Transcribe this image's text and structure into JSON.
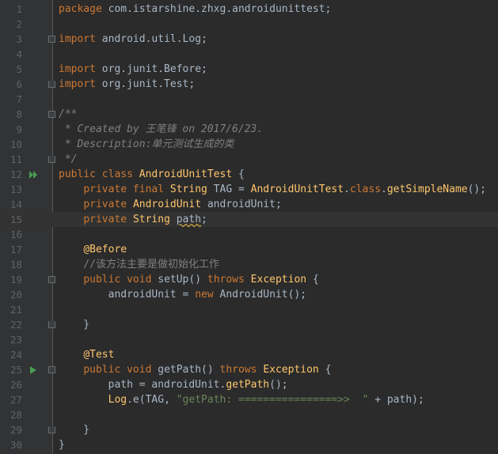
{
  "editor": {
    "colors": {
      "background": "#2b2b2b",
      "gutter": "#313335",
      "keyword": "#cc7832",
      "string": "#6a8759",
      "comment": "#808080",
      "annotation": "#bbb529",
      "function": "#ffc66d",
      "field": "#9876aa",
      "text": "#a9b7c6",
      "run_marker": "#499c54"
    },
    "lines": [
      {
        "num": "1",
        "marker": "",
        "fold": "",
        "tokens": [
          {
            "t": "package",
            "c": "kw"
          },
          {
            "t": " com.istarshine.zhxg.androidunittest;",
            "c": "pl"
          }
        ]
      },
      {
        "num": "2",
        "marker": "",
        "fold": "",
        "tokens": []
      },
      {
        "num": "3",
        "marker": "",
        "fold": "start",
        "tokens": [
          {
            "t": "import",
            "c": "kw"
          },
          {
            "t": " ",
            "c": "pl"
          },
          {
            "t": "android.util.Log;",
            "c": "pl"
          }
        ]
      },
      {
        "num": "4",
        "marker": "",
        "fold": "",
        "tokens": []
      },
      {
        "num": "5",
        "marker": "",
        "fold": "",
        "tokens": [
          {
            "t": "import",
            "c": "kw"
          },
          {
            "t": " org.junit.Before;",
            "c": "pl"
          }
        ]
      },
      {
        "num": "6",
        "marker": "",
        "fold": "end",
        "tokens": [
          {
            "t": "import",
            "c": "kw"
          },
          {
            "t": " org.junit.Test;",
            "c": "pl"
          }
        ]
      },
      {
        "num": "7",
        "marker": "",
        "fold": "",
        "tokens": []
      },
      {
        "num": "8",
        "marker": "",
        "fold": "start",
        "tokens": [
          {
            "t": "/**",
            "c": "cm"
          }
        ]
      },
      {
        "num": "9",
        "marker": "",
        "fold": "",
        "tokens": [
          {
            "t": " * Created by 王笔锋 on 2017/6/23.",
            "c": "cm"
          }
        ]
      },
      {
        "num": "10",
        "marker": "",
        "fold": "",
        "tokens": [
          {
            "t": " * Description:单元测试生成的类",
            "c": "cm"
          }
        ]
      },
      {
        "num": "11",
        "marker": "",
        "fold": "end",
        "tokens": [
          {
            "t": " */",
            "c": "cm"
          }
        ]
      },
      {
        "num": "12",
        "marker": "run-all",
        "fold": "",
        "tokens": [
          {
            "t": "public",
            "c": "kw"
          },
          {
            "t": " ",
            "c": "pl"
          },
          {
            "t": "class",
            "c": "kw"
          },
          {
            "t": " ",
            "c": "pl"
          },
          {
            "t": "AndroidUnitTest",
            "c": "an"
          },
          {
            "t": " {",
            "c": "pl"
          }
        ]
      },
      {
        "num": "13",
        "marker": "",
        "fold": "",
        "tokens": [
          {
            "t": "    ",
            "c": "pl"
          },
          {
            "t": "private final",
            "c": "kw"
          },
          {
            "t": " ",
            "c": "pl"
          },
          {
            "t": "String",
            "c": "an"
          },
          {
            "t": " TAG = ",
            "c": "pl"
          },
          {
            "t": "AndroidUnitTest",
            "c": "an"
          },
          {
            "t": ".",
            "c": "pl"
          },
          {
            "t": "class",
            "c": "kw"
          },
          {
            "t": ".",
            "c": "pl"
          },
          {
            "t": "getSimpleName",
            "c": "an"
          },
          {
            "t": "();",
            "c": "pl"
          }
        ]
      },
      {
        "num": "14",
        "marker": "",
        "fold": "",
        "tokens": [
          {
            "t": "    ",
            "c": "pl"
          },
          {
            "t": "private",
            "c": "kw"
          },
          {
            "t": " ",
            "c": "pl"
          },
          {
            "t": "AndroidUnit",
            "c": "an"
          },
          {
            "t": " androidUnit;",
            "c": "pl"
          }
        ]
      },
      {
        "num": "15",
        "marker": "",
        "fold": "",
        "current": true,
        "tokens": [
          {
            "t": "    ",
            "c": "pl"
          },
          {
            "t": "private",
            "c": "kw"
          },
          {
            "t": " ",
            "c": "pl"
          },
          {
            "t": "String",
            "c": "an"
          },
          {
            "t": " ",
            "c": "pl"
          },
          {
            "t": "path",
            "c": "warn"
          },
          {
            "t": ";",
            "c": "pl"
          }
        ]
      },
      {
        "num": "16",
        "marker": "",
        "fold": "",
        "tokens": []
      },
      {
        "num": "17",
        "marker": "",
        "fold": "",
        "tokens": [
          {
            "t": "    ",
            "c": "pl"
          },
          {
            "t": "@Before",
            "c": "an"
          }
        ]
      },
      {
        "num": "18",
        "marker": "",
        "fold": "",
        "tokens": [
          {
            "t": "    //该方法主要是做初始化工作",
            "c": "lc"
          }
        ]
      },
      {
        "num": "19",
        "marker": "",
        "fold": "start",
        "tokens": [
          {
            "t": "    ",
            "c": "pl"
          },
          {
            "t": "public",
            "c": "kw"
          },
          {
            "t": " ",
            "c": "pl"
          },
          {
            "t": "void",
            "c": "kw"
          },
          {
            "t": " setUp() ",
            "c": "pl"
          },
          {
            "t": "throws",
            "c": "kw"
          },
          {
            "t": " ",
            "c": "pl"
          },
          {
            "t": "Exception",
            "c": "an"
          },
          {
            "t": " {",
            "c": "pl"
          }
        ]
      },
      {
        "num": "20",
        "marker": "",
        "fold": "",
        "tokens": [
          {
            "t": "        androidUnit = ",
            "c": "pl"
          },
          {
            "t": "new",
            "c": "kw"
          },
          {
            "t": " AndroidUnit();",
            "c": "pl"
          }
        ]
      },
      {
        "num": "21",
        "marker": "",
        "fold": "",
        "tokens": []
      },
      {
        "num": "22",
        "marker": "",
        "fold": "end",
        "tokens": [
          {
            "t": "    }",
            "c": "pl"
          }
        ]
      },
      {
        "num": "23",
        "marker": "",
        "fold": "",
        "tokens": []
      },
      {
        "num": "24",
        "marker": "",
        "fold": "",
        "tokens": [
          {
            "t": "    ",
            "c": "pl"
          },
          {
            "t": "@Test",
            "c": "an"
          }
        ]
      },
      {
        "num": "25",
        "marker": "run",
        "fold": "start",
        "tokens": [
          {
            "t": "    ",
            "c": "pl"
          },
          {
            "t": "public",
            "c": "kw"
          },
          {
            "t": " ",
            "c": "pl"
          },
          {
            "t": "void",
            "c": "kw"
          },
          {
            "t": " getPath() ",
            "c": "pl"
          },
          {
            "t": "throws",
            "c": "kw"
          },
          {
            "t": " ",
            "c": "pl"
          },
          {
            "t": "Exception",
            "c": "an"
          },
          {
            "t": " {",
            "c": "pl"
          }
        ]
      },
      {
        "num": "26",
        "marker": "",
        "fold": "",
        "tokens": [
          {
            "t": "        path = androidUnit.",
            "c": "pl"
          },
          {
            "t": "getPath",
            "c": "an"
          },
          {
            "t": "();",
            "c": "pl"
          }
        ]
      },
      {
        "num": "27",
        "marker": "",
        "fold": "",
        "tokens": [
          {
            "t": "        ",
            "c": "pl"
          },
          {
            "t": "Log",
            "c": "an"
          },
          {
            "t": ".e(TAG, ",
            "c": "pl"
          },
          {
            "t": "\"getPath: ================>>  \"",
            "c": "st"
          },
          {
            "t": " + path);",
            "c": "pl"
          }
        ]
      },
      {
        "num": "28",
        "marker": "",
        "fold": "",
        "tokens": []
      },
      {
        "num": "29",
        "marker": "",
        "fold": "end",
        "tokens": [
          {
            "t": "    }",
            "c": "pl"
          }
        ]
      },
      {
        "num": "30",
        "marker": "",
        "fold": "",
        "tokens": [
          {
            "t": "}",
            "c": "pl"
          }
        ]
      }
    ]
  }
}
